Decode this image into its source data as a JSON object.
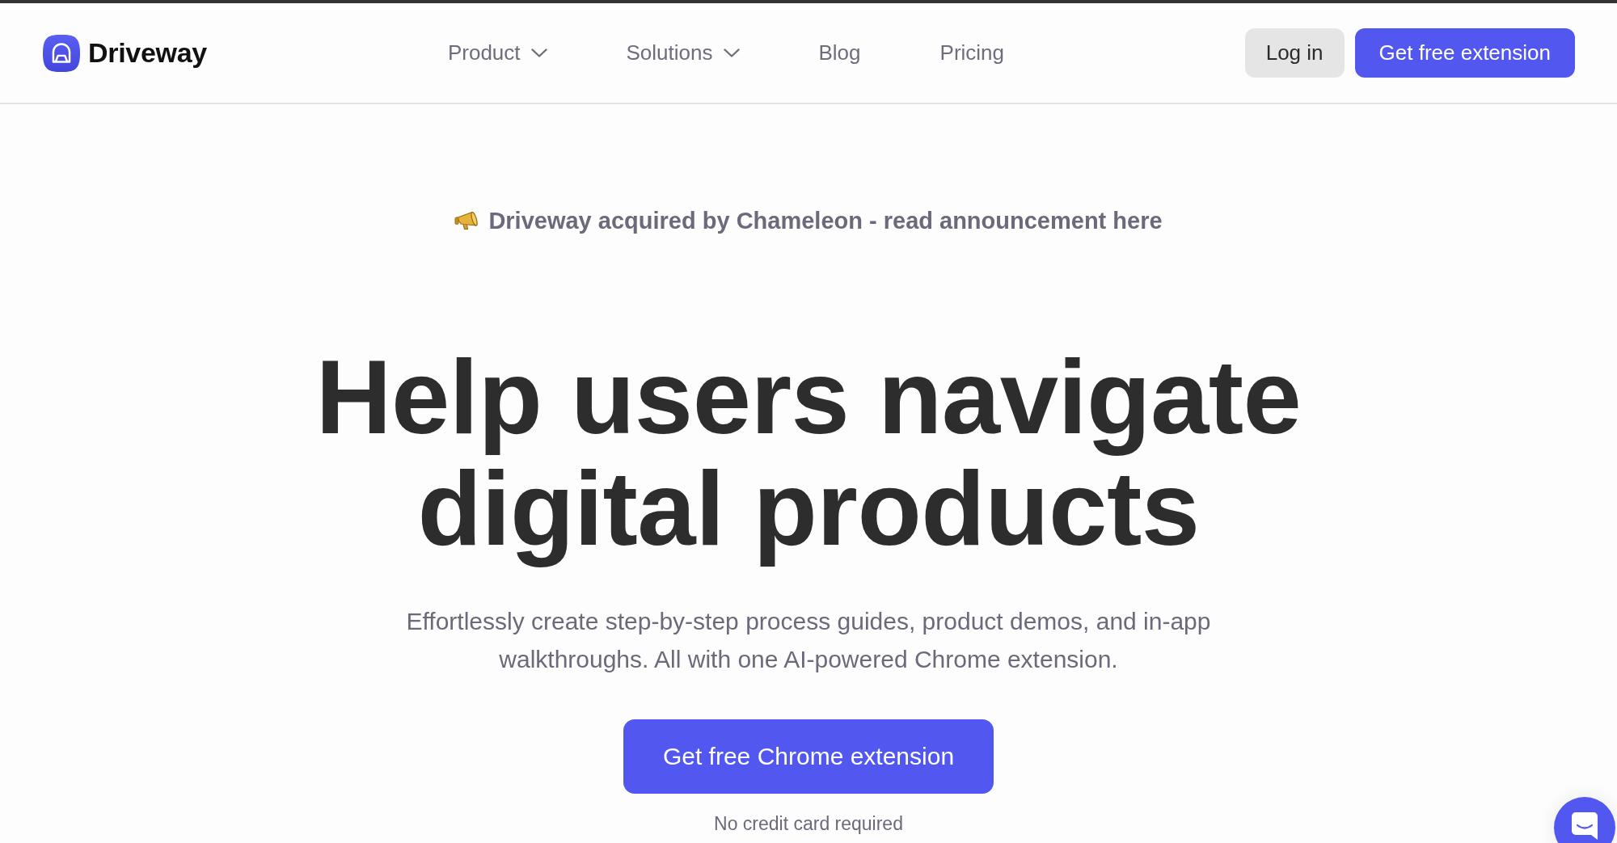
{
  "header": {
    "logo": {
      "name": "Driveway"
    },
    "nav": [
      {
        "label": "Product",
        "kind": "dropdown"
      },
      {
        "label": "Solutions",
        "kind": "dropdown"
      },
      {
        "label": "Blog",
        "kind": "link"
      },
      {
        "label": "Pricing",
        "kind": "link"
      }
    ],
    "buttons": [
      {
        "label": "Log in",
        "kind": "secondary"
      },
      {
        "label": "Get free extension",
        "kind": "primary"
      }
    ]
  },
  "announcement": {
    "text": "Driveway acquired by Chameleon - read announcement here"
  },
  "hero": {
    "title": "Help users navigate digital products",
    "subtitle": "Effortlessly create step-by-step process guides, product demos, and in-app walkthroughs. All with one AI-powered Chrome extension.",
    "cta": "Get free Chrome extension",
    "note": "No credit card required"
  }
}
